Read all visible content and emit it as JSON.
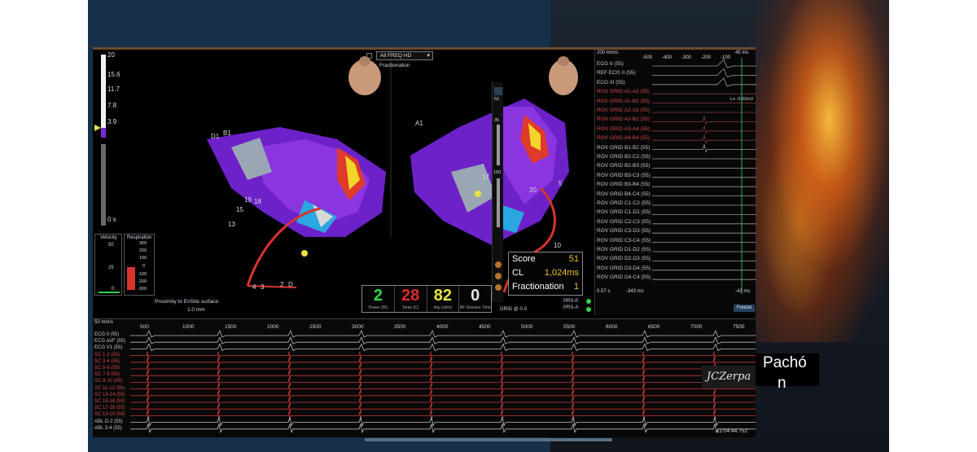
{
  "dropdown": {
    "selected": "All FREQ HD",
    "caption": "Fractionation"
  },
  "left_scale": {
    "ticks": [
      "20",
      "15.6",
      "11.7",
      "7.8",
      "3.9",
      "0 s"
    ]
  },
  "velocity": {
    "title": "Velocity",
    "ticks": [
      "50",
      "25",
      "0"
    ]
  },
  "respiration": {
    "title": "Respiration",
    "ticks": [
      "300",
      "200",
      "100",
      "0",
      "-100",
      "-200",
      "-300"
    ]
  },
  "proximity": {
    "line1": "Proximity to EnSite surface:",
    "line2": "1.0 mm"
  },
  "catheter_labels": [
    "D1",
    "B1",
    "A1",
    "19",
    "18",
    "17",
    "15",
    "13",
    "4",
    "3",
    "2",
    "D",
    "20",
    "5",
    "10"
  ],
  "stats": [
    {
      "value": "2",
      "caption": "Power (W)",
      "color": "#33d44b"
    },
    {
      "value": "28",
      "caption": "Temp (C)",
      "color": "#e02a2a"
    },
    {
      "value": "82",
      "caption": "Imp (ohm)",
      "color": "#e8e23a"
    },
    {
      "value": "0",
      "caption": "RF Session Time",
      "color": "#e6e6e6"
    }
  ],
  "score_box": [
    {
      "label": "Score",
      "value": "51"
    },
    {
      "label": "CL",
      "value": "1,024ms"
    },
    {
      "label": "Fractionation",
      "value": "1"
    }
  ],
  "grid_label": "GRID @ 0-0",
  "prs": [
    "PRS-P",
    "PRS-A"
  ],
  "map_rail": {
    "value_a": "52",
    "value_b": "35",
    "value_c": "150"
  },
  "ecg_top": {
    "scale_labels": [
      "200 mm/s",
      "-500",
      "-400",
      "-300",
      "-200",
      "-100",
      "45 ms"
    ],
    "channels": [
      {
        "name": "ECG II (55)",
        "color": "#c7c7c7"
      },
      {
        "name": "REF ECG II (55)",
        "color": "#c7c7c7"
      },
      {
        "name": "ECG III (55)",
        "color": "#c7c7c7"
      },
      {
        "name": "ROV GRID A1-A2 (55)",
        "color": "#d24a4a"
      },
      {
        "name": "ROV GRID A1-B1 (55)",
        "color": "#d24a4a"
      },
      {
        "name": "ROV GRID A2-A3 (55)",
        "color": "#d24a4a"
      },
      {
        "name": "ROV GRID A3-B2 (55)",
        "color": "#d24a4a"
      },
      {
        "name": "ROV GRID A3-A4 (55)",
        "color": "#d24a4a"
      },
      {
        "name": "ROV GRID A4-B4 (55)",
        "color": "#d24a4a"
      },
      {
        "name": "ROV GRID B1-B2 (55)",
        "color": "#c7c7c7"
      },
      {
        "name": "ROV GRID B2-C2 (55)",
        "color": "#c7c7c7"
      },
      {
        "name": "ROV GRID B2-B3 (55)",
        "color": "#c7c7c7"
      },
      {
        "name": "ROV GRID B3-C3 (55)",
        "color": "#c7c7c7"
      },
      {
        "name": "ROV GRID B3-B4 (55)",
        "color": "#c7c7c7"
      },
      {
        "name": "ROV GRID B4-C4 (55)",
        "color": "#c7c7c7"
      },
      {
        "name": "ROV GRID C1-C2 (55)",
        "color": "#c7c7c7"
      },
      {
        "name": "ROV GRID C1-D1 (55)",
        "color": "#c7c7c7"
      },
      {
        "name": "ROV GRID C2-C3 (55)",
        "color": "#c7c7c7"
      },
      {
        "name": "ROV GRID C3-D3 (55)",
        "color": "#c7c7c7"
      },
      {
        "name": "ROV GRID C3-C4 (55)",
        "color": "#c7c7c7"
      },
      {
        "name": "ROV GRID D1-D2 (55)",
        "color": "#c7c7c7"
      },
      {
        "name": "ROV GRID D2-D3 (55)",
        "color": "#c7c7c7"
      },
      {
        "name": "ROV GRID D3-D4 (55)",
        "color": "#c7c7c7"
      },
      {
        "name": "ROV GRID D4-C4 (55)",
        "color": "#c7c7c7"
      }
    ],
    "marker_left": "0.57 s",
    "marker_mid": "-343 ms",
    "marker_right": "-43 ms",
    "lo_label": "Lo -0.02mV",
    "freeze": "Freeze"
  },
  "bottom": {
    "scale_left": "50 mm/s",
    "ticks": [
      "500",
      "1000",
      "1500",
      "2000",
      "2500",
      "3000",
      "3500",
      "4000",
      "4500",
      "5000",
      "5500",
      "6000",
      "6500",
      "7000",
      "7500"
    ],
    "channels": [
      {
        "name": "ECG II (55)",
        "color": "#c7c7c7"
      },
      {
        "name": "ECG aVF (55)",
        "color": "#c7c7c7"
      },
      {
        "name": "ECG V1 (55)",
        "color": "#c7c7c7"
      },
      {
        "name": "SC 1-2 (55)",
        "color": "#d24a4a"
      },
      {
        "name": "SC 3-4 (55)",
        "color": "#d24a4a"
      },
      {
        "name": "SC 5-6 (55)",
        "color": "#d24a4a"
      },
      {
        "name": "SC 7-8 (55)",
        "color": "#d24a4a"
      },
      {
        "name": "SC 9-10 (55)",
        "color": "#d24a4a"
      },
      {
        "name": "SC 11-12 (55)",
        "color": "#d24a4a"
      },
      {
        "name": "SC 13-14 (55)",
        "color": "#d24a4a"
      },
      {
        "name": "SC 15-16 (55)",
        "color": "#d24a4a"
      },
      {
        "name": "SC 17-18 (55)",
        "color": "#d24a4a"
      },
      {
        "name": "SC 19-20 (55)",
        "color": "#d24a4a"
      },
      {
        "name": "ABL D-2 (55)",
        "color": "#c7c7c7"
      },
      {
        "name": "ABL 3-4 (55)",
        "color": "#c7c7c7"
      }
    ],
    "timestamp": "12:04:44.752"
  },
  "signature": "JCZerpa",
  "speaker": {
    "line1": "Pachó",
    "line2": "n"
  },
  "colors": {
    "accent_purple": "#7a2bd6",
    "catheter_red": "#d8332d",
    "background": "#163049"
  }
}
